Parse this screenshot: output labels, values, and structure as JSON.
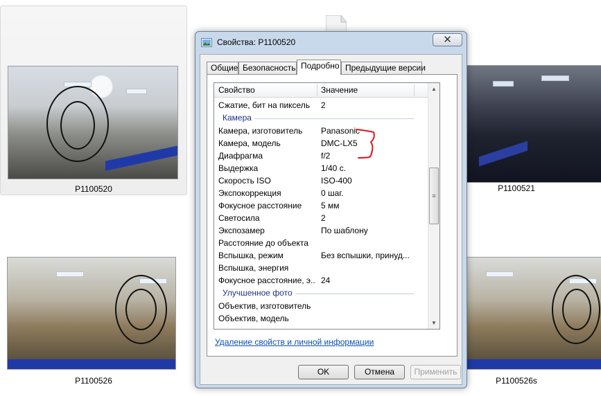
{
  "thumbnails": [
    {
      "name": "P1100520"
    },
    {
      "name": "P1100521"
    },
    {
      "name": "P1100526"
    },
    {
      "name": "P1100526s"
    }
  ],
  "dialog": {
    "title": "Свойства: P1100520",
    "close_glyph": "✕",
    "tabs": [
      "Общие",
      "Безопасность",
      "Подробно",
      "Предыдущие версии"
    ],
    "active_tab": "Подробно",
    "columns": {
      "property": "Свойство",
      "value": "Значение"
    },
    "rows": [
      {
        "prop": "Сжатие, бит на пиксель",
        "val": "2"
      },
      {
        "group": "Камера"
      },
      {
        "prop": "Камера, изготовитель",
        "val": "Panasonic"
      },
      {
        "prop": "Камера, модель",
        "val": "DMC-LX5"
      },
      {
        "prop": "Диафрагма",
        "val": "f/2"
      },
      {
        "prop": "Выдержка",
        "val": "1/40 с."
      },
      {
        "prop": "Скорость ISO",
        "val": "ISO-400"
      },
      {
        "prop": "Экспокоррекция",
        "val": "0 шаг."
      },
      {
        "prop": "Фокусное расстояние",
        "val": "5 мм"
      },
      {
        "prop": "Светосила",
        "val": "2"
      },
      {
        "prop": "Экспозамер",
        "val": "По шаблону"
      },
      {
        "prop": "Расстояние до объекта",
        "val": ""
      },
      {
        "prop": "Вспышка, режим",
        "val": "Без вспышки, принуд..."
      },
      {
        "prop": "Вспышка, энергия",
        "val": ""
      },
      {
        "prop": "Фокусное расстояние, э...",
        "val": "24"
      },
      {
        "group": "Улучшенное фото"
      },
      {
        "prop": "Объектив, изготовитель",
        "val": ""
      },
      {
        "prop": "Объектив, модель",
        "val": ""
      }
    ],
    "remove_link": "Удаление свойств и личной информации",
    "buttons": {
      "ok": "OK",
      "cancel": "Отмена",
      "apply": "Применить"
    }
  }
}
